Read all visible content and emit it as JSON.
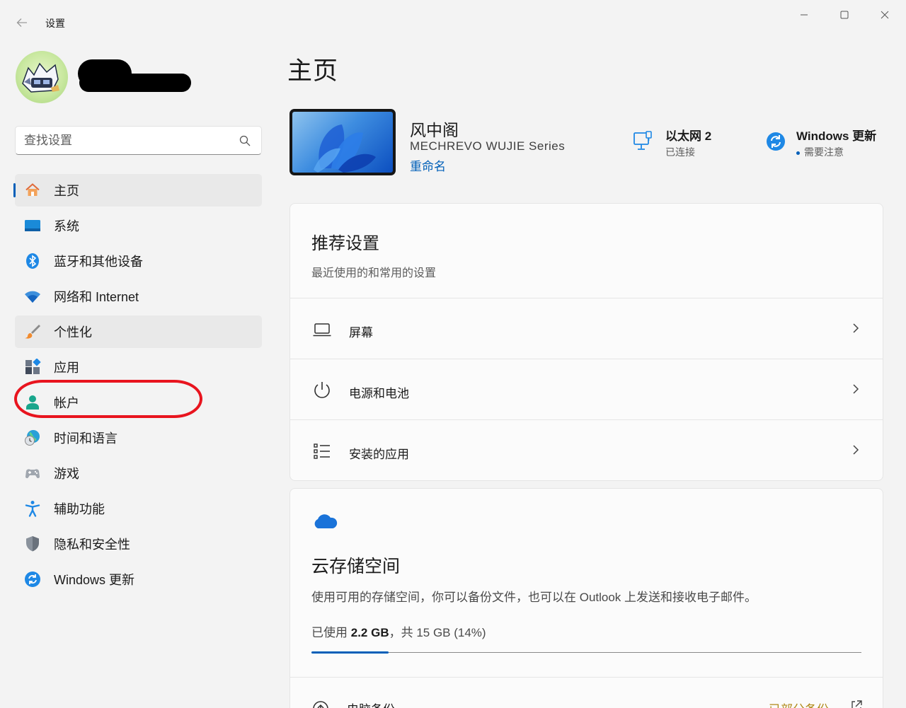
{
  "window": {
    "title": "设置"
  },
  "search": {
    "placeholder": "查找设置"
  },
  "sidebar": {
    "items": [
      {
        "label": "主页"
      },
      {
        "label": "系统"
      },
      {
        "label": "蓝牙和其他设备"
      },
      {
        "label": "网络和 Internet"
      },
      {
        "label": "个性化"
      },
      {
        "label": "应用"
      },
      {
        "label": "帐户"
      },
      {
        "label": "时间和语言"
      },
      {
        "label": "游戏"
      },
      {
        "label": "辅助功能"
      },
      {
        "label": "隐私和安全性"
      },
      {
        "label": "Windows 更新"
      }
    ]
  },
  "main": {
    "title": "主页",
    "device": {
      "name": "风中阁",
      "model": "MECHREVO  WUJIE  Series",
      "rename": "重命名"
    },
    "network": {
      "title": "以太网 2",
      "status": "已连接"
    },
    "update": {
      "title": "Windows 更新",
      "status": "需要注意"
    },
    "recommended": {
      "title": "推荐设置",
      "subtitle": "最近使用的和常用的设置",
      "rows": [
        {
          "label": "屏幕"
        },
        {
          "label": "电源和电池"
        },
        {
          "label": "安装的应用"
        }
      ]
    },
    "cloud": {
      "title": "云存储空间",
      "description": "使用可用的存储空间，你可以备份文件，也可以在 Outlook 上发送和接收电子邮件。",
      "used_prefix": "已使用 ",
      "used": "2.2 GB",
      "total_text": "，共 15 GB (14%)",
      "used_fraction": 0.14,
      "backup_label": "电脑备份",
      "backup_link": "已部分备份"
    }
  },
  "colors": {
    "accent": "#005fb8",
    "annotation": "#e8141e"
  }
}
